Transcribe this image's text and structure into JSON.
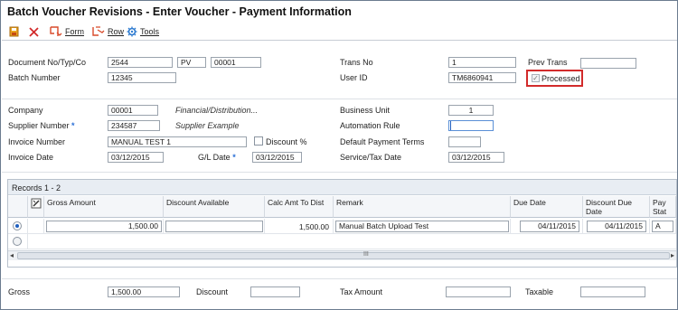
{
  "window": {
    "title": "Batch Voucher Revisions - Enter Voucher - Payment Information"
  },
  "toolbar": {
    "form_label": "Form",
    "row_label": "Row",
    "tools_label": "Tools"
  },
  "header": {
    "doc_label": "Document No/Typ/Co",
    "doc_no": "2544",
    "doc_type": "PV",
    "doc_co": "00001",
    "batch_label": "Batch Number",
    "batch_no": "12345",
    "trans_no_label": "Trans No",
    "trans_no": "1",
    "prev_trans_label": "Prev Trans",
    "prev_trans": "",
    "user_id_label": "User ID",
    "user_id": "TM6860941",
    "processed_label": "Processed",
    "processed_checked": true
  },
  "invoice": {
    "company_label": "Company",
    "company": "00001",
    "company_desc": "Financial/Distribution...",
    "supplier_label": "Supplier Number",
    "supplier_no": "234587",
    "supplier_desc": "Supplier Example",
    "invoice_no_label": "Invoice Number",
    "invoice_no": "MANUAL TEST 1",
    "discount_pct_label": "Discount %",
    "invoice_date_label": "Invoice Date",
    "invoice_date": "03/12/2015",
    "gl_date_label": "G/L Date",
    "gl_date": "03/12/2015",
    "business_unit_label": "Business Unit",
    "business_unit": "1",
    "automation_rule_label": "Automation Rule",
    "automation_rule": "",
    "default_payment_terms_label": "Default Payment Terms",
    "default_payment_terms": "",
    "service_tax_date_label": "Service/Tax Date",
    "service_tax_date": "03/12/2015"
  },
  "grid": {
    "records_label": "Records 1 - 2",
    "columns": {
      "gross_amount": "Gross Amount",
      "discount_available": "Discount Available",
      "calc_amt": "Calc Amt To Dist",
      "remark": "Remark",
      "due_date": "Due Date",
      "discount_due_date": "Discount Due Date",
      "pay_stat": "Pay Stat"
    },
    "rows": [
      {
        "gross_amount": "1,500.00",
        "discount_available": "",
        "calc_amt": "1,500.00",
        "remark": "Manual Batch Upload Test",
        "due_date": "04/11/2015",
        "discount_due_date": "04/11/2015",
        "pay_stat": "A"
      }
    ],
    "scroll_grip": "III"
  },
  "totals": {
    "gross_label": "Gross",
    "gross": "1,500.00",
    "discount_label": "Discount",
    "discount": "",
    "tax_label": "Tax Amount",
    "tax": "",
    "taxable_label": "Taxable",
    "taxable": ""
  },
  "colors": {
    "highlight_box": "#d22b2b",
    "required_star": "#2a6fd6",
    "accent": "#1f5fbf"
  }
}
